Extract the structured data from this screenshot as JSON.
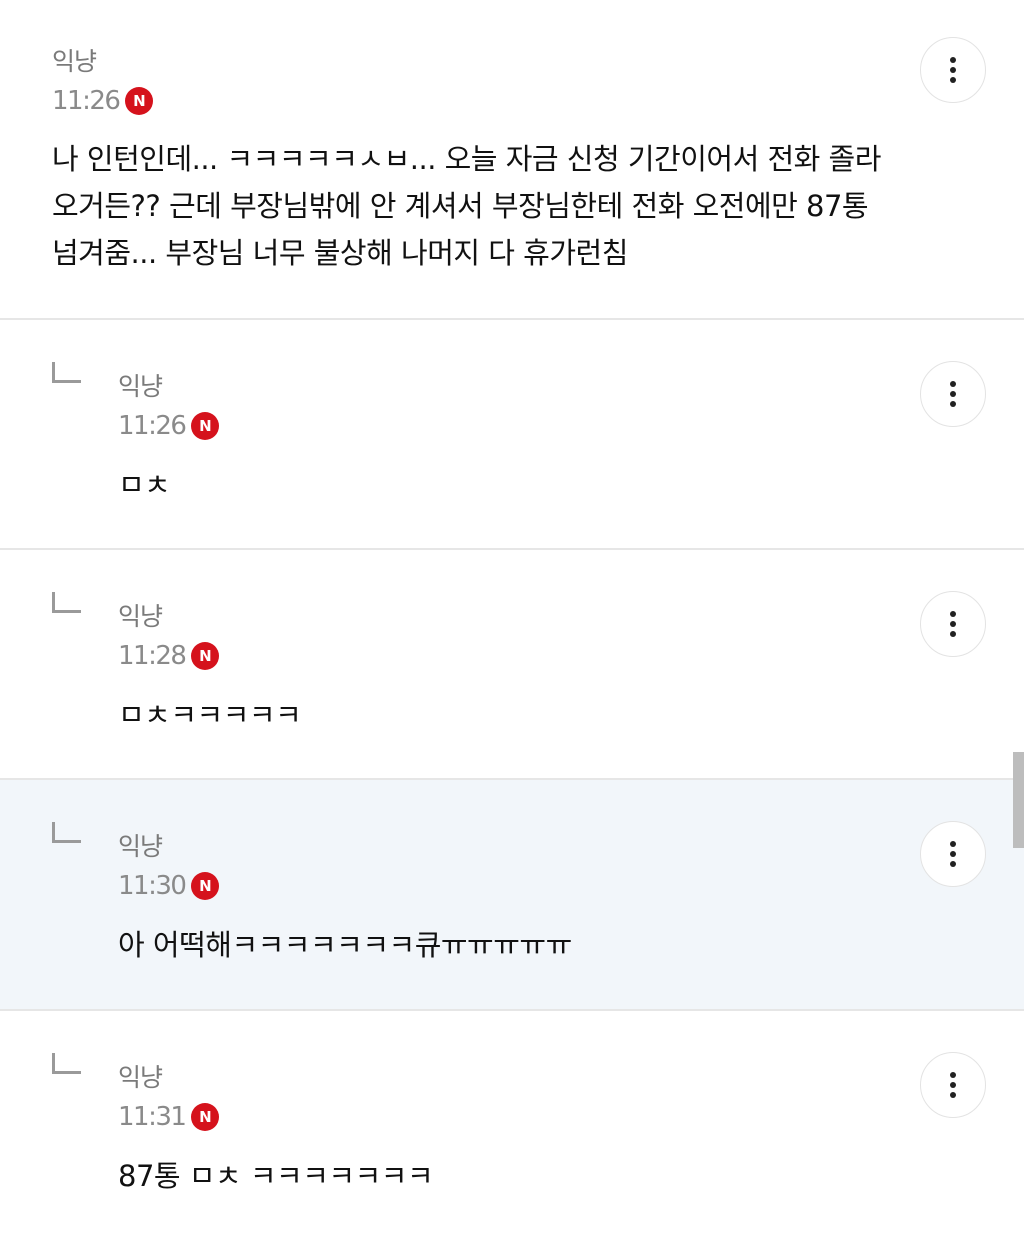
{
  "post": {
    "author": "익냥",
    "time": "11:26",
    "new_badge": "N",
    "lines": [
      "나 인턴인데... ㅋㅋㅋㅋㅋㅅㅂ... 오늘 자금 신청 기간이어서 전화 졸라",
      "오거든?? 근데 부장님밖에 안 계셔서 부장님한테 전화 오전에만 87통",
      "넘겨줌... 부장님 너무 불상해 나머지 다 휴가런침"
    ],
    "more_icon": "more-vertical-icon"
  },
  "replies": [
    {
      "author": "익냥",
      "time": "11:26",
      "new_badge": "N",
      "text": "ㅁㅊ",
      "highlighted": false
    },
    {
      "author": "익냥",
      "time": "11:28",
      "new_badge": "N",
      "text": "ㅁㅊㅋㅋㅋㅋㅋ",
      "highlighted": false
    },
    {
      "author": "익냥",
      "time": "11:30",
      "new_badge": "N",
      "text": "아 어떡해ㅋㅋㅋㅋㅋㅋㅋ큐ㅠㅠㅠㅠㅠ",
      "highlighted": true
    },
    {
      "author": "익냥",
      "time": "11:31",
      "new_badge": "N",
      "text": "87통 ㅁㅊ ㅋㅋㅋㅋㅋㅋㅋ",
      "highlighted": false
    }
  ],
  "icons": {
    "reply": "reply-arrow-icon",
    "more": "more-vertical-icon"
  },
  "colors": {
    "badge": "#d5121c",
    "highlight_bg": "#f2f6fa"
  }
}
